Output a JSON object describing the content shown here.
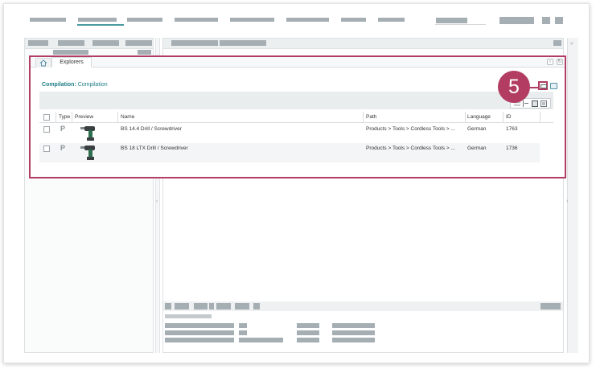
{
  "explorer": {
    "tab_label": "Explorers",
    "compilation_label": "Compilation:",
    "compilation_value": "Compilation",
    "callout_number": "5",
    "columns": [
      "Type",
      "Preview",
      "Name",
      "Path",
      "Language",
      "ID"
    ],
    "rows": [
      {
        "type": "P",
        "name": "BS 14.4 Drill / Screwdriver",
        "path": "Products > Tools > Cordless Tools > ...",
        "language": "German",
        "id": "1763"
      },
      {
        "type": "P",
        "name": "BS 18 LTX Drill / Screwdriver",
        "path": "Products > Tools > Cordless Tools > ...",
        "language": "German",
        "id": "1736"
      }
    ]
  },
  "icons": [
    "home-icon",
    "print-icon",
    "list-view-icon",
    "tree-view-icon",
    "single-view-icon",
    "detail-view-icon",
    "collapse-icon"
  ],
  "colors": {
    "highlight": "#b23c62",
    "accent": "#1f7f86",
    "placeholder_block": "#a5aeb3"
  }
}
